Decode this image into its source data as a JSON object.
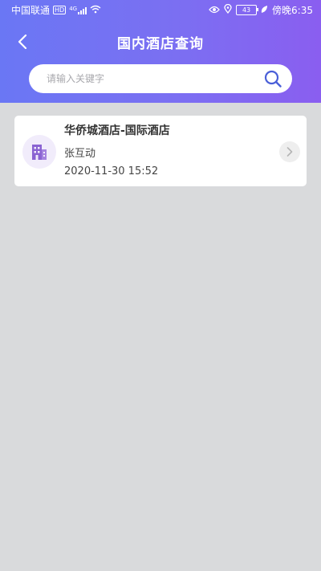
{
  "status_bar": {
    "carrier": "中国联通",
    "hd": "HD",
    "network": "4G",
    "battery": "43",
    "time_label": "傍晚6:35"
  },
  "nav": {
    "title": "国内酒店查询"
  },
  "search": {
    "placeholder": "请输入关键字",
    "value": ""
  },
  "results": [
    {
      "hotel_name": "华侨城酒店-国际酒店",
      "person": "张互动",
      "datetime": "2020-11-30 15:52"
    }
  ],
  "icons": {
    "back": "back-arrow-icon",
    "search": "search-icon",
    "hotel": "building-icon",
    "chevron": "chevron-right-icon"
  },
  "colors": {
    "header_gradient_start": "#6a77f4",
    "header_gradient_end": "#8a5ef0",
    "page_background": "#d9dadc",
    "hotel_icon": "#8a63d2"
  }
}
